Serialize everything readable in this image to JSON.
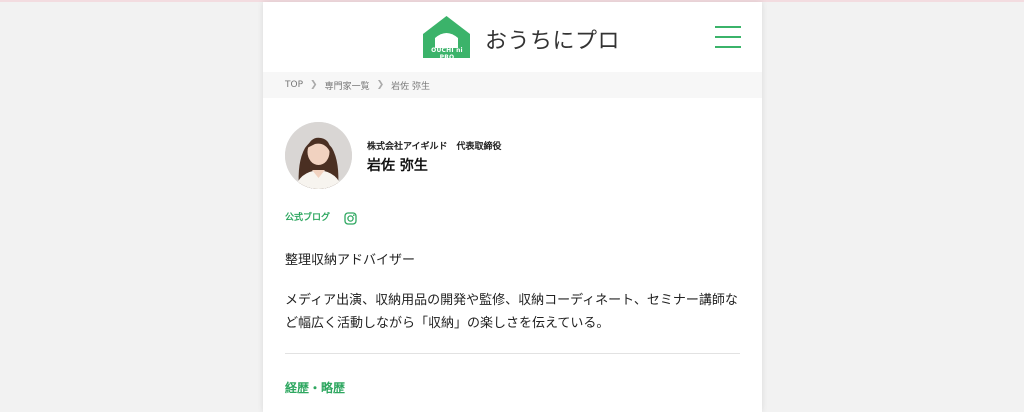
{
  "header": {
    "logo_mark_text": "OUCHI ni PRO",
    "logo_text": "おうちにプロ",
    "brand_color": "#3bb36a"
  },
  "breadcrumb": {
    "items": [
      "TOP",
      "専門家一覧",
      "岩佐 弥生"
    ]
  },
  "profile": {
    "company": "株式会社アイギルド　代表取締役",
    "name": "岩佐 弥生",
    "links": {
      "blog": "公式ブログ",
      "instagram_icon": "instagram-icon"
    },
    "occupation": "整理収納アドバイザー",
    "description": "メディア出演、収納用品の開発や監修、収納コーディネート、セミナー講師など幅広く活動しながら「収納」の楽しさを伝えている。"
  },
  "sections": {
    "career_title": "経歴・略歴"
  }
}
